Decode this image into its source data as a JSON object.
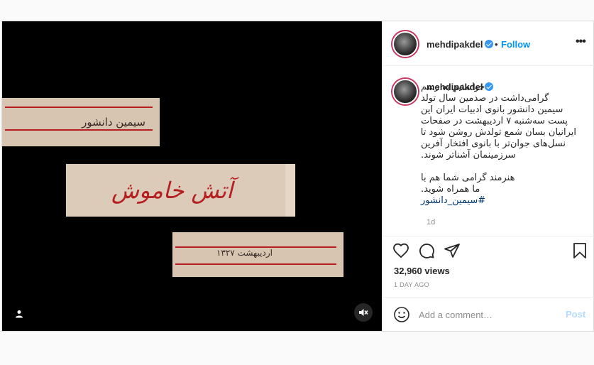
{
  "colors": {
    "accent": "#0095f6",
    "verified": "#3897f0",
    "story_ring": "#c7365f",
    "card_red": "#b51f22"
  },
  "media": {
    "card1_text": "سیمین دانشور",
    "card2_text": "آتش خاموش",
    "card3_text": "اردیبهشت ۱۳۲۷",
    "user_tag_icon": "user-tag-icon",
    "mute_icon": "muted-speaker-icon"
  },
  "header": {
    "username": "mehdipakdel",
    "separator": "•",
    "follow_label": "Follow",
    "more_label": "•••"
  },
  "caption": {
    "username": "mehdipakdel",
    "lines": [
      "خواستیم به رسم",
      "گرامی‌داشت در صدمین سال تولد",
      "سیمین دانشور بانوی ادبیات ایران این",
      "پست سه‌شنبه ۷ اردیبهشت در صفحات",
      "ایرانیان بسان شمع تولدش روشن شود تا",
      "نسل‌های جوان‌تر با بانوی افتخار آفرین",
      "سرزمینمان آشناتر شوند."
    ],
    "lines2": [
      "هنرمند گرامی شما هم با",
      "ما همراه شوید."
    ],
    "hashtag": "#سیمین_دانشور",
    "time": "1d"
  },
  "actions": {
    "like_icon": "heart-icon",
    "comment_icon": "comment-icon",
    "share_icon": "share-icon",
    "save_icon": "bookmark-icon"
  },
  "stats": {
    "views": "32,960 views",
    "date": "1 DAY AGO"
  },
  "comment": {
    "placeholder": "Add a comment…",
    "post_label": "Post",
    "emoji_icon": "emoji-icon"
  }
}
